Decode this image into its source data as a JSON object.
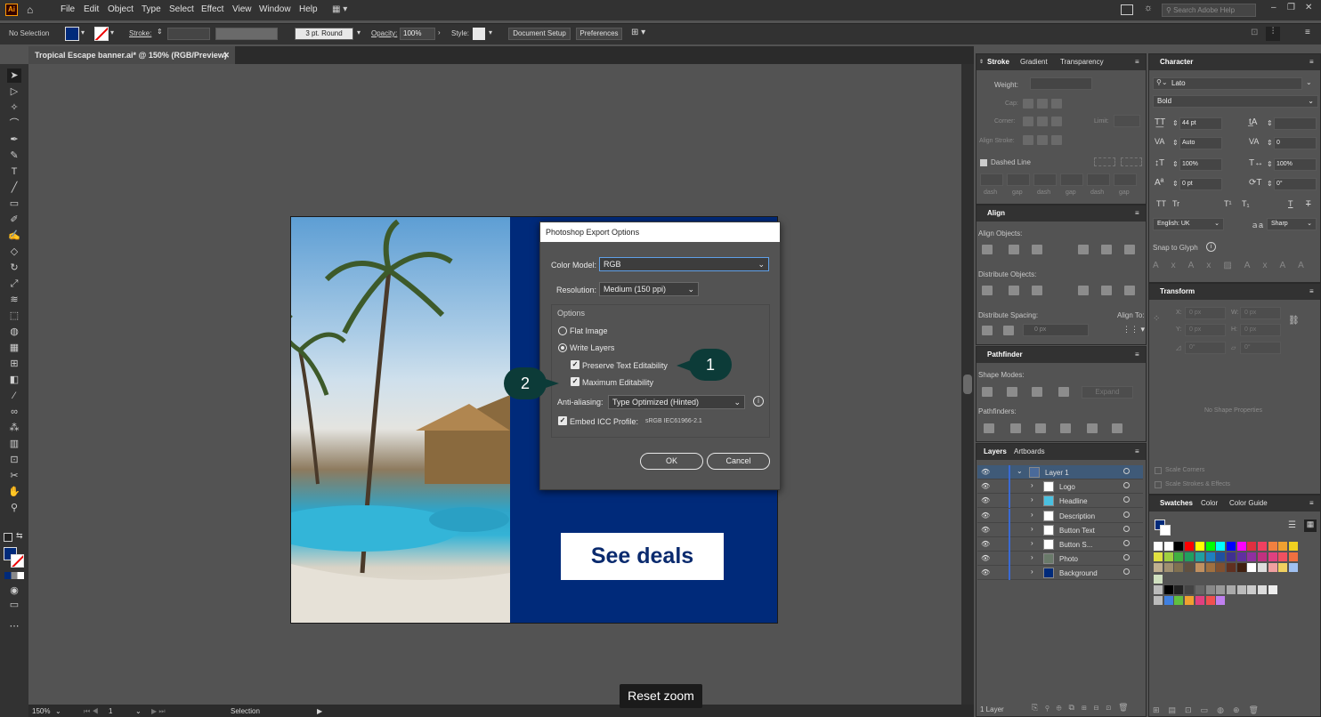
{
  "app": {
    "logo": "Ai",
    "menu": [
      "File",
      "Edit",
      "Object",
      "Type",
      "Select",
      "Effect",
      "View",
      "Window",
      "Help"
    ],
    "search_placeholder": "Search Adobe Help"
  },
  "control_bar": {
    "selection": "No Selection",
    "stroke_label": "Stroke:",
    "brush": "3 pt. Round",
    "opacity_label": "Opacity:",
    "opacity": "100%",
    "style_label": "Style:",
    "doc_setup": "Document Setup",
    "preferences": "Preferences"
  },
  "doc_tab": {
    "title": "Tropical Escape banner.ai* @ 150% (RGB/Preview)"
  },
  "artboard": {
    "cta": "See deals"
  },
  "dialog": {
    "title": "Photoshop Export Options",
    "color_model_label": "Color Model:",
    "color_model": "RGB",
    "resolution_label": "Resolution:",
    "resolution": "Medium (150 ppi)",
    "options_label": "Options",
    "flat_image": "Flat Image",
    "write_layers": "Write Layers",
    "preserve_text": "Preserve Text Editability",
    "max_edit": "Maximum Editability",
    "aa_label": "Anti-aliasing:",
    "aa": "Type Optimized (Hinted)",
    "embed_label": "Embed ICC Profile:",
    "icc": "sRGB IEC61966-2.1",
    "ok": "OK",
    "cancel": "Cancel"
  },
  "callouts": {
    "one": "1",
    "two": "2"
  },
  "stroke_panel": {
    "tabs": [
      "Stroke",
      "Gradient",
      "Transparency"
    ],
    "weight": "Weight:",
    "cap": "Cap:",
    "corner": "Corner:",
    "limit": "Limit:",
    "align_stroke": "Align Stroke:",
    "dashed": "Dashed Line",
    "dash_labels": [
      "dash",
      "gap",
      "dash",
      "gap",
      "dash",
      "gap"
    ]
  },
  "align_panel": {
    "title": "Align",
    "align_objects": "Align Objects:",
    "distribute_objects": "Distribute Objects:",
    "distribute_spacing": "Distribute Spacing:",
    "align_to": "Align To:",
    "spacing_value": "0 px"
  },
  "pathfinder": {
    "title": "Pathfinder",
    "shape_modes": "Shape Modes:",
    "expand": "Expand",
    "pathfinders": "Pathfinders:"
  },
  "layers": {
    "tabs": [
      "Layers",
      "Artboards"
    ],
    "rows": [
      "Layer 1",
      "Logo",
      "Headline",
      "Description",
      "Button Text",
      "Button S...",
      "Photo",
      "Background"
    ],
    "footer": "1 Layer"
  },
  "character": {
    "title": "Character",
    "font": "Lato",
    "style": "Bold",
    "size": "44 pt",
    "leading": "",
    "kerning": "Auto",
    "tracking": "0",
    "vscale": "100%",
    "hscale": "100%",
    "baseline": "0 pt",
    "rotation": "0°",
    "language": "English: UK",
    "aa": "Sharp",
    "snap": "Snap to Glyph",
    "tt": "TT",
    "tr": "Tr",
    "t1": "T¹",
    "t2": "T₁"
  },
  "transform": {
    "title": "Transform",
    "x": "X:",
    "y": "Y:",
    "w": "W:",
    "h": "H:",
    "x_val": "0 px",
    "y_val": "0 px",
    "w_val": "0 px",
    "h_val": "0 px",
    "rot": "0°",
    "shear": "0°",
    "no_props": "No Shape Properties",
    "scale_corners": "Scale Corners",
    "scale_strokes": "Scale Strokes & Effects"
  },
  "swatches": {
    "tabs": [
      "Swatches",
      "Color",
      "Color Guide"
    ]
  },
  "status": {
    "zoom": "150%",
    "page": "1",
    "tool": "Selection"
  },
  "reset_zoom": "Reset zoom",
  "colors": {
    "accent": "#002a7a",
    "callout": "#0c3b38"
  }
}
